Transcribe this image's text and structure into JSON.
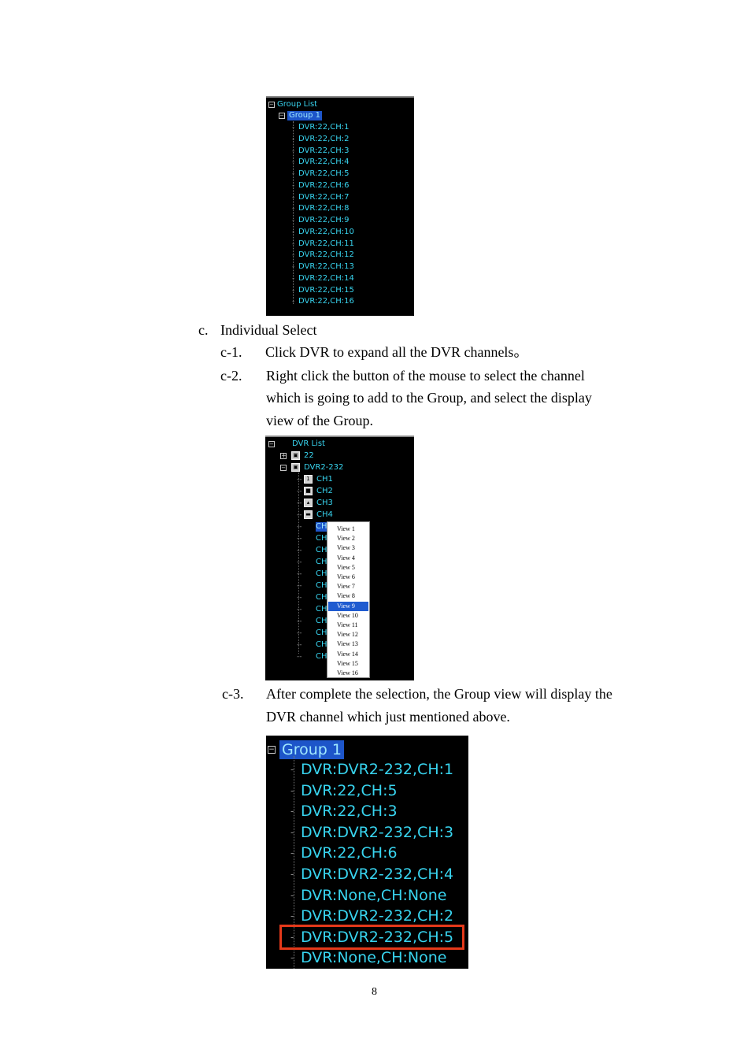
{
  "panel_group_list": {
    "root": "Group List",
    "group": "Group 1",
    "items": [
      "DVR:22,CH:1",
      "DVR:22,CH:2",
      "DVR:22,CH:3",
      "DVR:22,CH:4",
      "DVR:22,CH:5",
      "DVR:22,CH:6",
      "DVR:22,CH:7",
      "DVR:22,CH:8",
      "DVR:22,CH:9",
      "DVR:22,CH:10",
      "DVR:22,CH:11",
      "DVR:22,CH:12",
      "DVR:22,CH:13",
      "DVR:22,CH:14",
      "DVR:22,CH:15",
      "DVR:22,CH:16"
    ]
  },
  "section_c": {
    "marker": "c.",
    "title": "Individual Select",
    "steps": [
      {
        "num": "c-1.",
        "lines": [
          "Click DVR to expand all the DVR channels。"
        ]
      },
      {
        "num": "c-2.",
        "lines": [
          "Right click the button of the mouse to select the channel",
          "which is going to add to the Group, and select the display",
          "view of the Group."
        ]
      },
      {
        "num": "c-3.",
        "lines": [
          "After complete the selection, the Group view will display the",
          "DVR channel which just mentioned above."
        ]
      }
    ]
  },
  "panel_dvr_list": {
    "root": "DVR List",
    "dvr1": "22",
    "dvr2": "DVR2-232",
    "channels": [
      "CH1",
      "CH2",
      "CH3",
      "CH4"
    ],
    "channel_icons": [
      "1",
      "■",
      "▴",
      "▬"
    ],
    "truncated_ch": "CH",
    "menu": [
      "View 1",
      "View 2",
      "View 3",
      "View 4",
      "View 5",
      "View 6",
      "View 7",
      "View 8",
      "View 9",
      "View 10",
      "View 11",
      "View 12",
      "View 13",
      "View 14",
      "View 15",
      "View 16"
    ],
    "menu_selected_index": 8
  },
  "panel_group_view": {
    "group": "Group 1",
    "items": [
      "DVR:DVR2-232,CH:1",
      "DVR:22,CH:5",
      "DVR:22,CH:3",
      "DVR:DVR2-232,CH:3",
      "DVR:22,CH:6",
      "DVR:DVR2-232,CH:4",
      "DVR:None,CH:None",
      "DVR:DVR2-232,CH:2",
      "DVR:DVR2-232,CH:5",
      "DVR:None,CH:None"
    ],
    "highlighted_index": 8,
    "highlight_color": "#e5391a"
  },
  "page_number": "8",
  "colors": {
    "tree_text": "#38d4ef",
    "selection": "#1d55c9",
    "menu_selection": "#1f5bd0"
  }
}
